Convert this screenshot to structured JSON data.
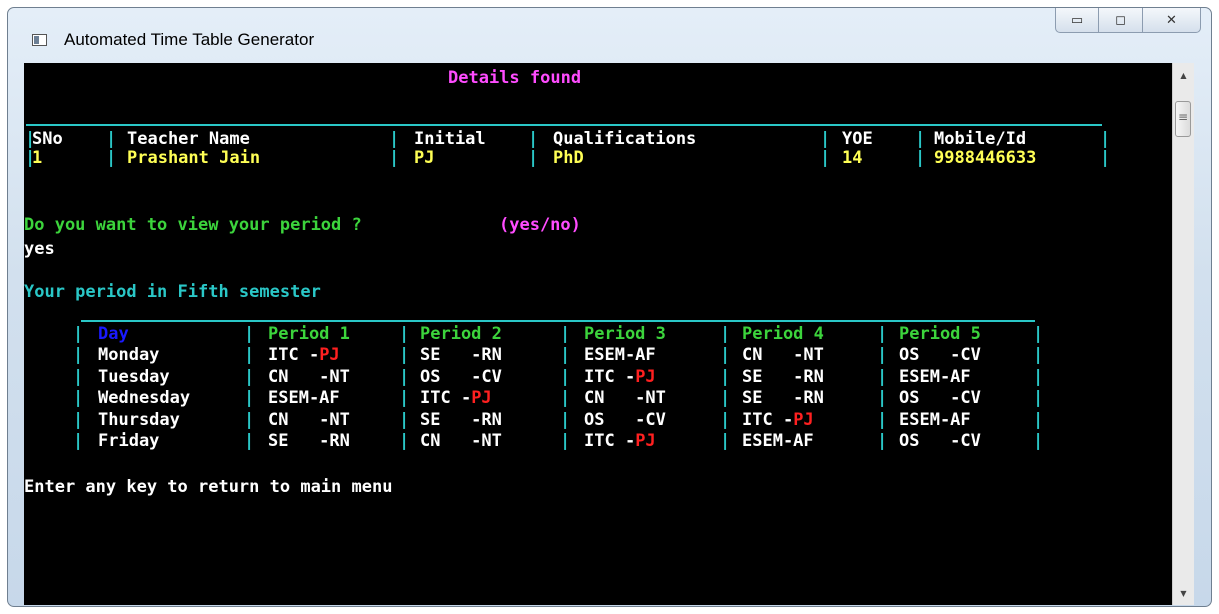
{
  "window": {
    "title": "Automated Time Table Generator",
    "controls": {
      "minimize": "▭",
      "maximize": "◻",
      "close": "✕"
    }
  },
  "colors": {
    "magenta": "#ff4cff",
    "cyan": "#2ac7c7",
    "yellow": "#ffff55",
    "green": "#3cd43c",
    "blue": "#1a1aff",
    "red": "#ff2020",
    "white": "#ffffff"
  },
  "console": {
    "details_heading": "Details found",
    "teacher_table": {
      "headers": [
        "SNo",
        "Teacher Name",
        "Initial",
        "Qualifications",
        "YOE",
        "Mobile/Id"
      ],
      "row": [
        "1",
        "Prashant Jain",
        "PJ",
        "PhD",
        "14",
        "9988446633"
      ]
    },
    "prompt_text": "Do you want to view your period ?",
    "prompt_choice": "(yes/no)",
    "answer": "yes",
    "semester_line": "Your period in Fifth semester",
    "timetable": {
      "headers": [
        "Day",
        "Period 1",
        "Period 2",
        "Period 3",
        "Period 4",
        "Period 5"
      ],
      "rows": [
        {
          "day": "Monday",
          "cells": [
            [
              "ITC -",
              "PJ"
            ],
            [
              "SE   -RN",
              ""
            ],
            [
              "ESEM-AF",
              ""
            ],
            [
              "CN   -NT",
              ""
            ],
            [
              "OS   -CV",
              ""
            ]
          ]
        },
        {
          "day": "Tuesday",
          "cells": [
            [
              "CN   -NT",
              ""
            ],
            [
              "OS   -CV",
              ""
            ],
            [
              "ITC -",
              "PJ"
            ],
            [
              "SE   -RN",
              ""
            ],
            [
              "ESEM-AF",
              ""
            ]
          ]
        },
        {
          "day": "Wednesday",
          "cells": [
            [
              "ESEM-AF",
              ""
            ],
            [
              "ITC -",
              "PJ"
            ],
            [
              "CN   -NT",
              ""
            ],
            [
              "SE   -RN",
              ""
            ],
            [
              "OS   -CV",
              ""
            ]
          ]
        },
        {
          "day": "Thursday",
          "cells": [
            [
              "CN   -NT",
              ""
            ],
            [
              "SE   -RN",
              ""
            ],
            [
              "OS   -CV",
              ""
            ],
            [
              "ITC -",
              "PJ"
            ],
            [
              "ESEM-AF",
              ""
            ]
          ]
        },
        {
          "day": "Friday",
          "cells": [
            [
              "SE   -RN",
              ""
            ],
            [
              "CN   -NT",
              ""
            ],
            [
              "ITC -",
              "PJ"
            ],
            [
              "ESEM-AF",
              ""
            ],
            [
              "OS   -CV",
              ""
            ]
          ]
        }
      ]
    },
    "footer_prompt": "Enter any key to return to main menu"
  }
}
